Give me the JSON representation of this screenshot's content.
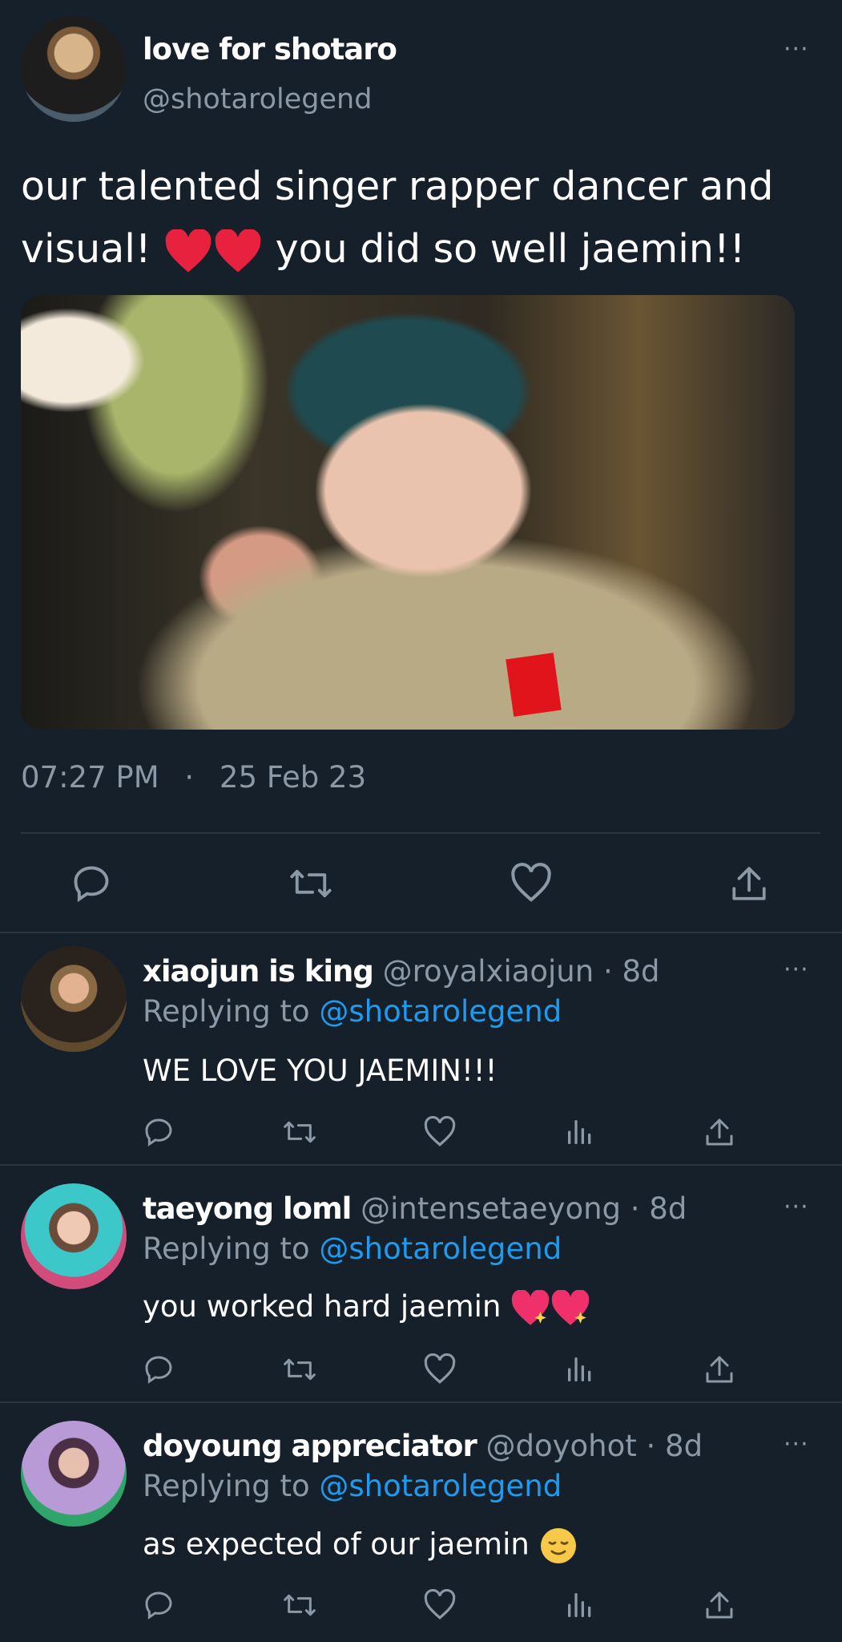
{
  "main_tweet": {
    "display_name": "love for shotaro",
    "handle": "@shotarolegend",
    "text_line1": "our talented singer rapper dancer and",
    "text_line2_a": "visual!",
    "text_line2_b": "you did so well jaemin!!",
    "time": "07:27 PM",
    "separator": "·",
    "date": "25 Feb 23",
    "more": "···"
  },
  "replies": [
    {
      "display_name": "xiaojun is king",
      "handle": "@royalxiaojun",
      "age": "· 8d",
      "replying_prefix": "Replying to",
      "replying_handle": "@shotarolegend",
      "text": "WE LOVE YOU JAEMIN!!!",
      "more": "···"
    },
    {
      "display_name": "taeyong loml",
      "handle": "@intensetaeyong",
      "age": "· 8d",
      "replying_prefix": "Replying to",
      "replying_handle": "@shotarolegend",
      "text": "you worked hard jaemin",
      "more": "···"
    },
    {
      "display_name": "doyoung appreciator",
      "handle": "@doyohot",
      "age": "· 8d",
      "replying_prefix": "Replying to",
      "replying_handle": "@shotarolegend",
      "text": "as expected of our jaemin",
      "more": "···"
    }
  ],
  "icons": {
    "reply": "reply-icon",
    "retweet": "retweet-icon",
    "like": "like-icon",
    "views": "views-icon",
    "share": "share-icon"
  },
  "colors": {
    "background": "#15202b",
    "link": "#1d9bf0",
    "muted": "#8b98a5",
    "heart": "#f91880"
  }
}
